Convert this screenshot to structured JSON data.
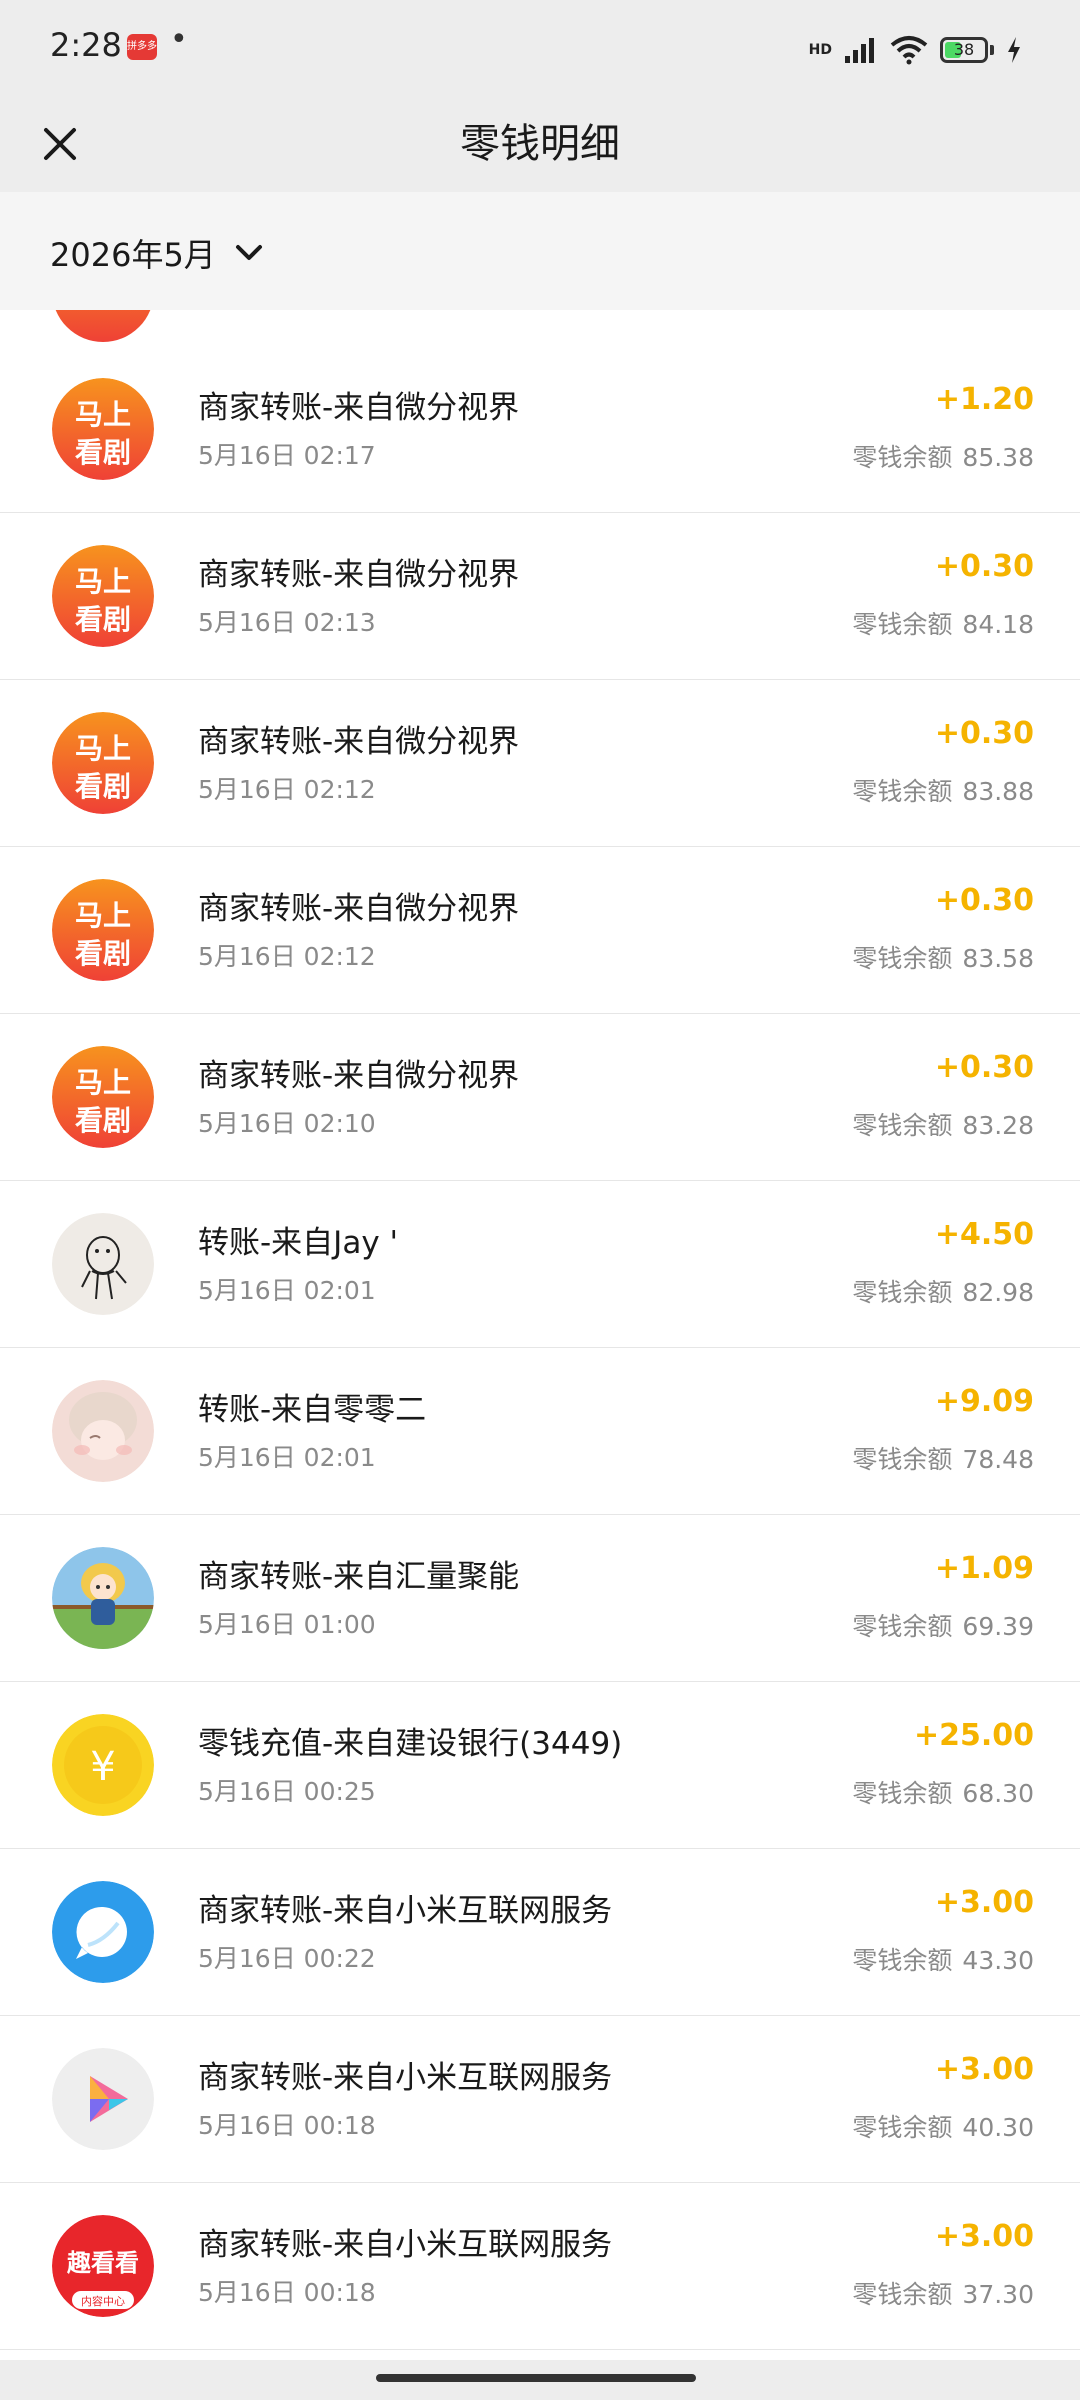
{
  "status_bar": {
    "time": "2:28",
    "notif_label": "拼多多",
    "dot": "•",
    "hd_label": "HD",
    "battery": "38"
  },
  "header": {
    "title": "零钱明细",
    "close_icon": "close-icon"
  },
  "filter": {
    "month": "2026年5月",
    "chevron_icon": "chevron-down-icon"
  },
  "transactions": [
    {
      "title": "商家转账-来自微分视界",
      "time": "5月16日 02:17",
      "amount": "+1.20",
      "balance_label": "零钱余额",
      "balance": "85.38",
      "avatar": "mashang"
    },
    {
      "title": "商家转账-来自微分视界",
      "time": "5月16日 02:13",
      "amount": "+0.30",
      "balance_label": "零钱余额",
      "balance": "84.18",
      "avatar": "mashang"
    },
    {
      "title": "商家转账-来自微分视界",
      "time": "5月16日 02:12",
      "amount": "+0.30",
      "balance_label": "零钱余额",
      "balance": "83.88",
      "avatar": "mashang"
    },
    {
      "title": "商家转账-来自微分视界",
      "time": "5月16日 02:12",
      "amount": "+0.30",
      "balance_label": "零钱余额",
      "balance": "83.58",
      "avatar": "mashang"
    },
    {
      "title": "商家转账-来自微分视界",
      "time": "5月16日 02:10",
      "amount": "+0.30",
      "balance_label": "零钱余额",
      "balance": "83.28",
      "avatar": "mashang"
    },
    {
      "title": "转账-来自Jay '",
      "time": "5月16日 02:01",
      "amount": "+4.50",
      "balance_label": "零钱余额",
      "balance": "82.98",
      "avatar": "doodle"
    },
    {
      "title": "转账-来自零零二",
      "time": "5月16日 02:01",
      "amount": "+9.09",
      "balance_label": "零钱余额",
      "balance": "78.48",
      "avatar": "anime"
    },
    {
      "title": "商家转账-来自汇量聚能",
      "time": "5月16日 01:00",
      "amount": "+1.09",
      "balance_label": "零钱余额",
      "balance": "69.39",
      "avatar": "girl"
    },
    {
      "title": "零钱充值-来自建设银行(3449)",
      "time": "5月16日 00:25",
      "amount": "+25.00",
      "balance_label": "零钱余额",
      "balance": "68.30",
      "avatar": "coin"
    },
    {
      "title": "商家转账-来自小米互联网服务",
      "time": "5月16日 00:22",
      "amount": "+3.00",
      "balance_label": "零钱余额",
      "balance": "43.30",
      "avatar": "bubble"
    },
    {
      "title": "商家转账-来自小米互联网服务",
      "time": "5月16日 00:18",
      "amount": "+3.00",
      "balance_label": "零钱余额",
      "balance": "40.30",
      "avatar": "play"
    },
    {
      "title": "商家转账-来自小米互联网服务",
      "time": "5月16日 00:18",
      "amount": "+3.00",
      "balance_label": "零钱余额",
      "balance": "37.30",
      "avatar": "qukankan"
    }
  ],
  "avatar_text": {
    "mashang_top": "马上",
    "mashang_bottom": "看剧",
    "coin": "¥",
    "qukankan": "趣看看",
    "qukankan_sub": "内容中心"
  },
  "colors": {
    "amount": "#f5b300",
    "secondary_text": "#8a8a8a",
    "background": "#ededed"
  }
}
